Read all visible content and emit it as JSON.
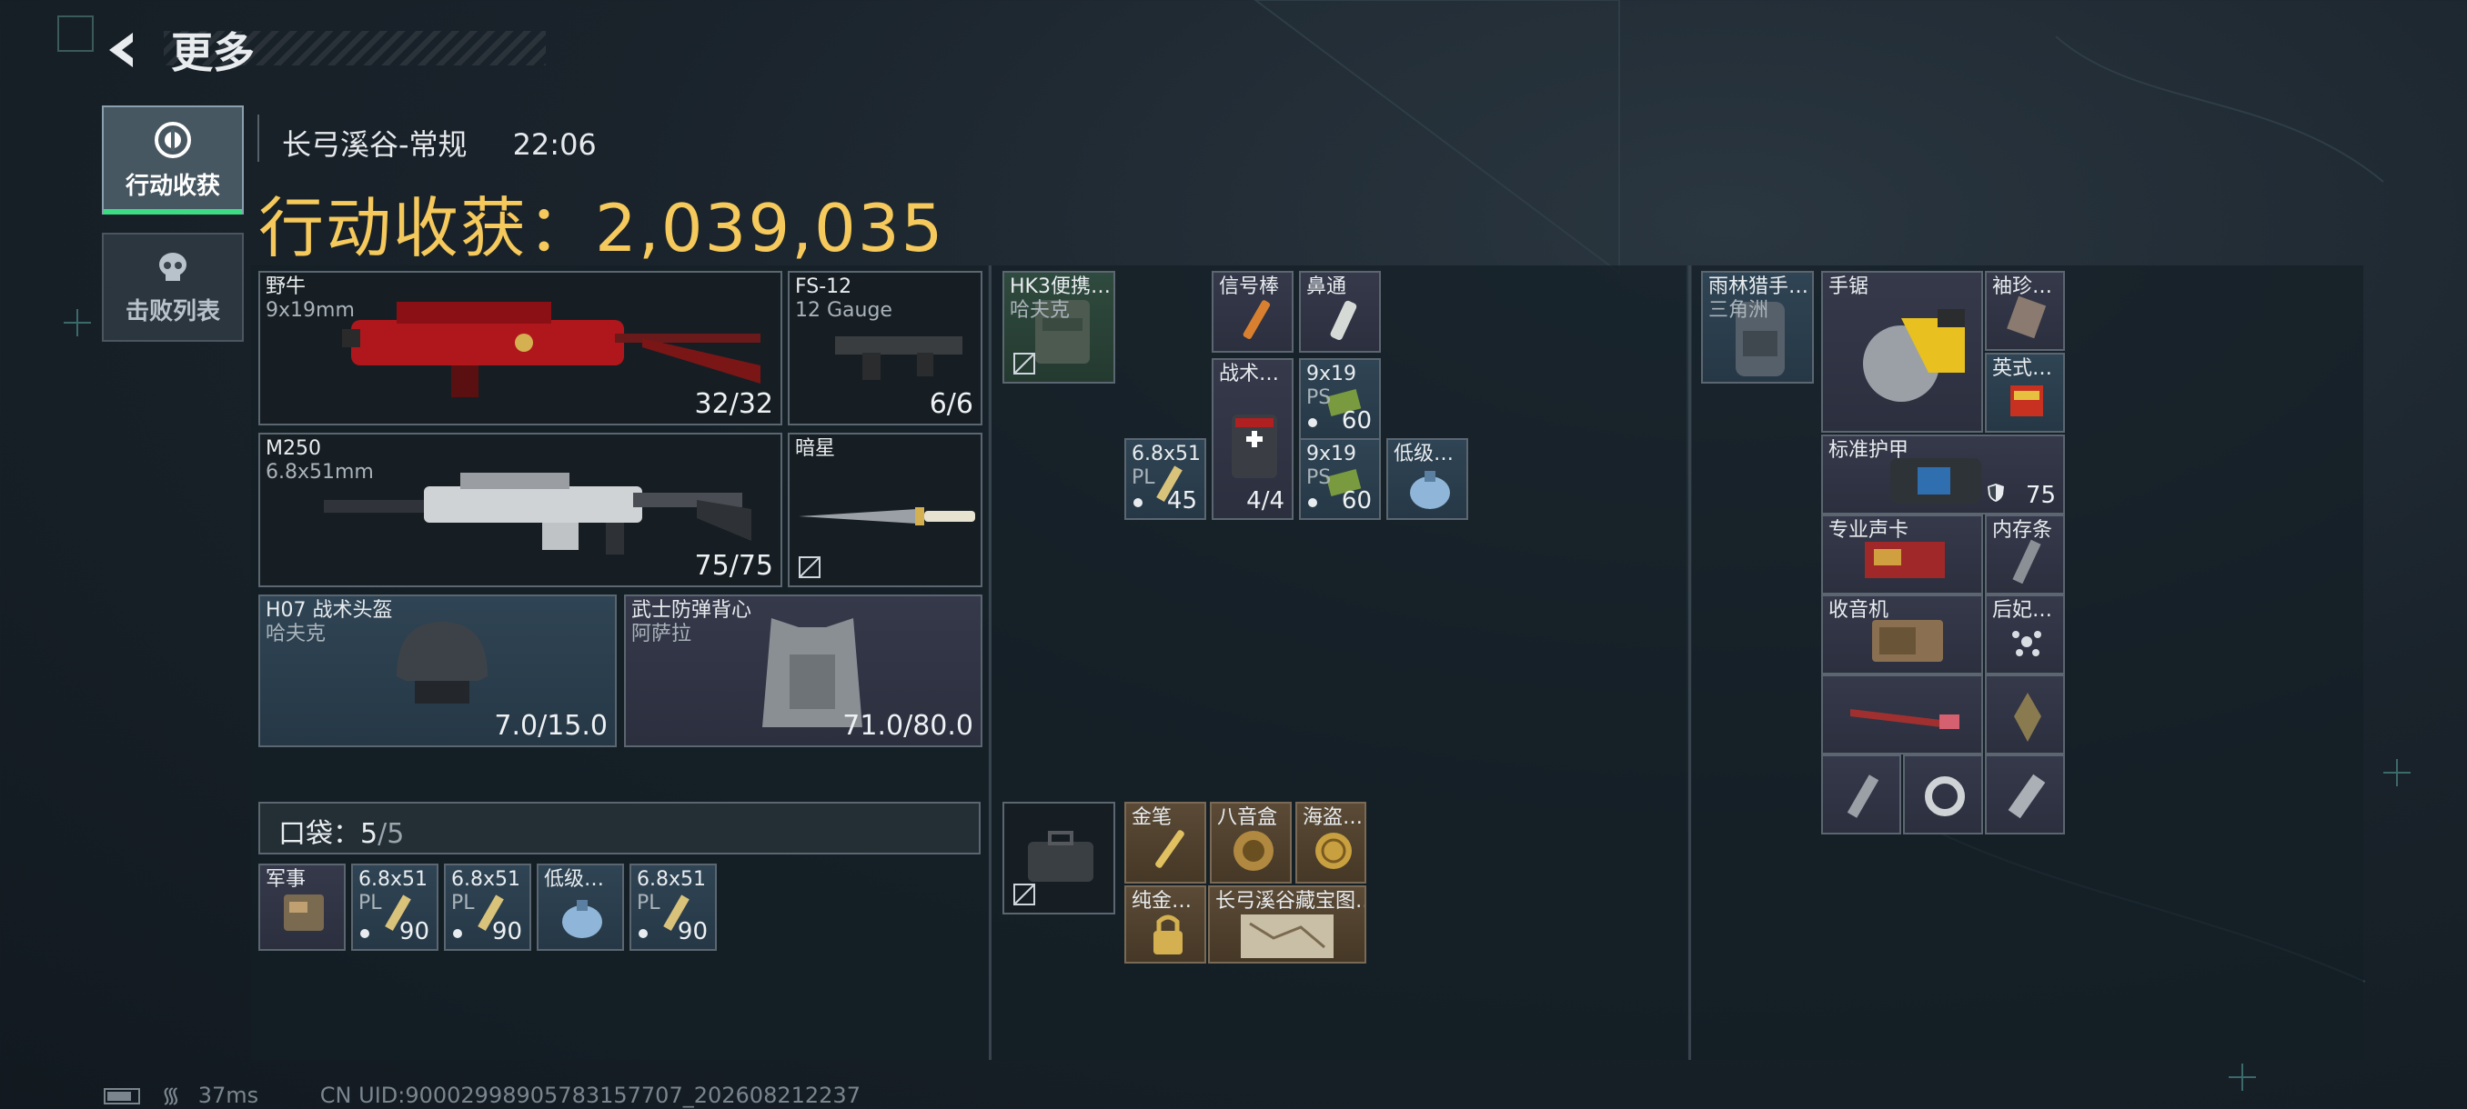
{
  "header": {
    "title": "更多"
  },
  "side_tabs": [
    {
      "label": "行动收获",
      "active": true
    },
    {
      "label": "击败列表",
      "active": false
    }
  ],
  "raid": {
    "map": "长弓溪谷-常规",
    "time": "22:06",
    "gain_label": "行动收获：",
    "gain_value": "2,039,035"
  },
  "loadout": {
    "primary": {
      "name": "野牛",
      "caliber": "9x19mm",
      "ammo": "32/32"
    },
    "shotgun": {
      "name": "FS-12",
      "caliber": "12 Gauge",
      "ammo": "6/6"
    },
    "secondary": {
      "name": "M250",
      "caliber": "6.8x51mm",
      "ammo": "75/75"
    },
    "melee": {
      "name": "暗星"
    },
    "helmet": {
      "name": "H07 战术头盔",
      "brand": "哈夫克",
      "durability": "7.0/15.0"
    },
    "armor": {
      "name": "武士防弹背心",
      "brand": "阿萨拉",
      "durability": "71.0/80.0"
    }
  },
  "pocket": {
    "label": "口袋：",
    "count": "5",
    "capacity": "/5",
    "items": [
      {
        "name": "军事",
        "rarity": "purple"
      },
      {
        "name": "6.8x51",
        "sub": "PL",
        "count": "90",
        "rarity": "blue"
      },
      {
        "name": "6.8x51",
        "sub": "PL",
        "count": "90",
        "rarity": "blue"
      },
      {
        "name": "低级…",
        "rarity": "blue"
      },
      {
        "name": "6.8x51",
        "sub": "PL",
        "count": "90",
        "rarity": "blue"
      }
    ]
  },
  "chest_rig": {
    "rig": {
      "name": "HK3便携…",
      "brand": "哈夫克"
    },
    "items": [
      {
        "name": "信号棒"
      },
      {
        "name": "鼻通"
      },
      {
        "name": "战术…",
        "count": "4/4"
      },
      {
        "name": "9x19",
        "sub": "PS",
        "count": "60"
      },
      {
        "name": "6.8x51",
        "sub": "PL",
        "count": "45"
      },
      {
        "name": "9x19",
        "sub": "PS",
        "count": "60"
      },
      {
        "name": "低级…"
      }
    ]
  },
  "case": {
    "items": [
      {
        "name": "金笔"
      },
      {
        "name": "八音盒"
      },
      {
        "name": "海盗…"
      },
      {
        "name": "纯金…"
      },
      {
        "name": "长弓溪谷藏宝图…"
      }
    ]
  },
  "backpack": {
    "bag": {
      "name": "雨林猎手…",
      "brand": "三角洲"
    },
    "items": [
      {
        "name": "手锯"
      },
      {
        "name": "袖珍…"
      },
      {
        "name": "英式…"
      },
      {
        "name": "标准护甲",
        "value": "75"
      },
      {
        "name": "专业声卡"
      },
      {
        "name": "内存条"
      },
      {
        "name": "收音机"
      },
      {
        "name": "后妃…"
      }
    ]
  },
  "footer": {
    "ping": "37ms",
    "uid": "CN UID:9000299890578315770​7_202608212237"
  },
  "colors": {
    "accent_gold": "#f5c95b",
    "active_tab": "#3ddc84"
  }
}
